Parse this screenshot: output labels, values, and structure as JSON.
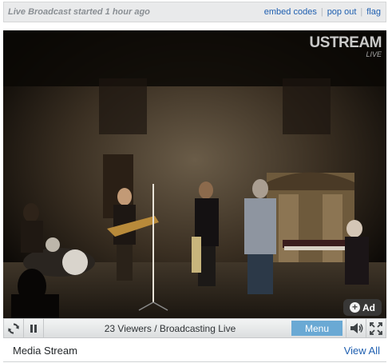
{
  "topbar": {
    "status": "Live Broadcast started 1 hour ago",
    "links": [
      "embed codes",
      "pop out",
      "flag"
    ],
    "separator": "|"
  },
  "player": {
    "watermark_brand": "USTREAM",
    "watermark_tag": "LIVE",
    "ad_label": "Ad",
    "ad_icon": "plus-circle-icon"
  },
  "controls": {
    "refresh_icon": "refresh-icon",
    "pause_icon": "pause-icon",
    "viewers_text": "23 Viewers / Broadcasting Live",
    "menu_label": "Menu",
    "volume_icon": "speaker-icon",
    "fullscreen_icon": "fullscreen-icon"
  },
  "footer": {
    "title": "Media Stream",
    "view_all": "View All"
  },
  "colors": {
    "link": "#1f5fb0",
    "menu_button": "#6aa9d4",
    "topbar_bg": "#e9eaeb"
  }
}
